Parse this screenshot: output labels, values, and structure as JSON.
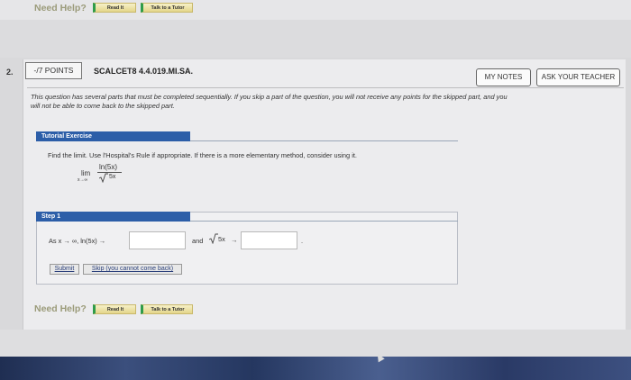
{
  "top_help": {
    "need_help": "Need Help?",
    "read_it": "Read It",
    "talk_tutor": "Talk to a Tutor"
  },
  "question": {
    "number": "2.",
    "points": "-/7 POINTS",
    "id": "SCALCET8 4.4.019.MI.SA.",
    "my_notes": "MY NOTES",
    "ask_teacher": "ASK YOUR TEACHER",
    "instruction_line1": "This question has several parts that must be completed sequentially. If you skip a part of the question, you will not receive any points for the skipped part, and you",
    "instruction_line2": "will not be able to come back to the skipped part."
  },
  "tutorial": {
    "header": "Tutorial Exercise",
    "prompt": "Find the limit. Use l'Hospital's Rule if appropriate. If there is a more elementary method, consider using it.",
    "lim": "lim",
    "lim_sub": "x→∞",
    "numerator": "ln(5x)",
    "denominator": "5x"
  },
  "step": {
    "header": "Step 1",
    "as_text": "As x → ∞,  ln(5x) →",
    "and_text": "and",
    "sqrt_arg": "5x",
    "arrow": "→",
    "period": ".",
    "input1_value": "",
    "input2_value": "",
    "submit": "Submit",
    "skip": "Skip (you cannot come back)"
  },
  "bottom_help": {
    "need_help": "Need Help?",
    "read_it": "Read It",
    "talk_tutor": "Talk to a Tutor"
  }
}
